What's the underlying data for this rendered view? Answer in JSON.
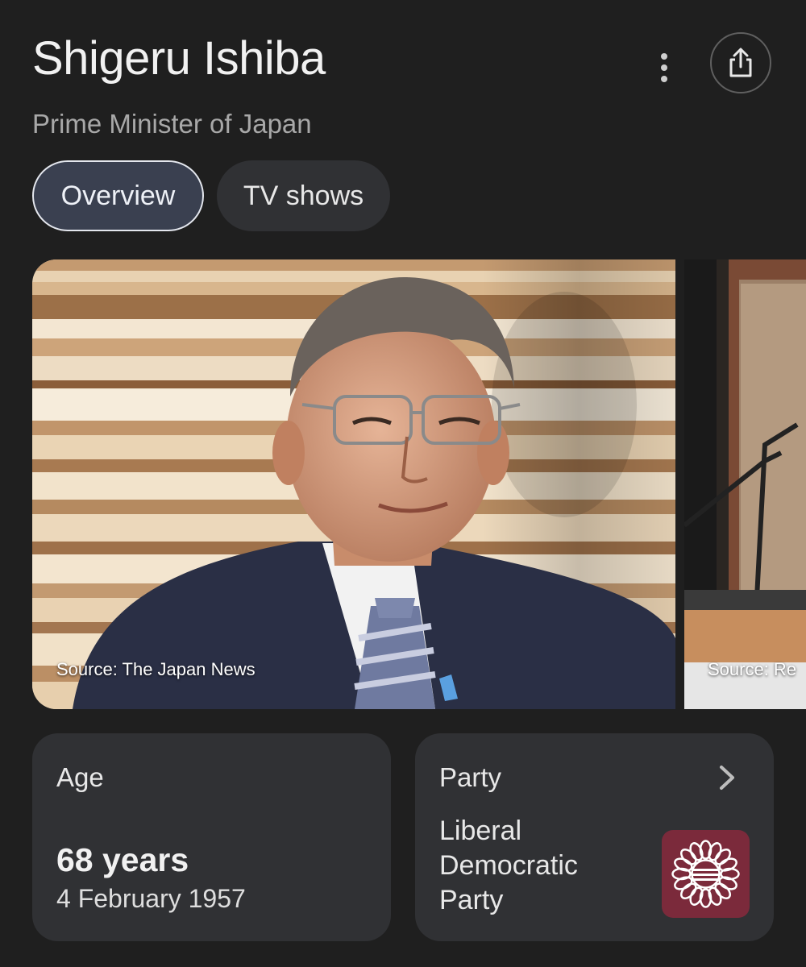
{
  "header": {
    "title": "Shigeru Ishiba",
    "subtitle": "Prime Minister of Japan",
    "more_icon": "more-vert-icon",
    "share_icon": "share-icon"
  },
  "tabs": [
    {
      "label": "Overview",
      "selected": true
    },
    {
      "label": "TV shows",
      "selected": false
    }
  ],
  "images": [
    {
      "source": "Source: The Japan News"
    },
    {
      "source": "Source: Re"
    }
  ],
  "cards": {
    "age": {
      "label": "Age",
      "value": "68 years",
      "birth_date": "4 February 1957"
    },
    "party": {
      "label": "Party",
      "name": "Liberal Democratic Party",
      "chevron_icon": "chevron-right-icon",
      "logo_icon": "ldp-logo-icon"
    }
  },
  "colors": {
    "background": "#1f1f1f",
    "card": "#303134",
    "tab_selected": "#3a4050",
    "party_logo_bg": "#7b2a3b"
  }
}
